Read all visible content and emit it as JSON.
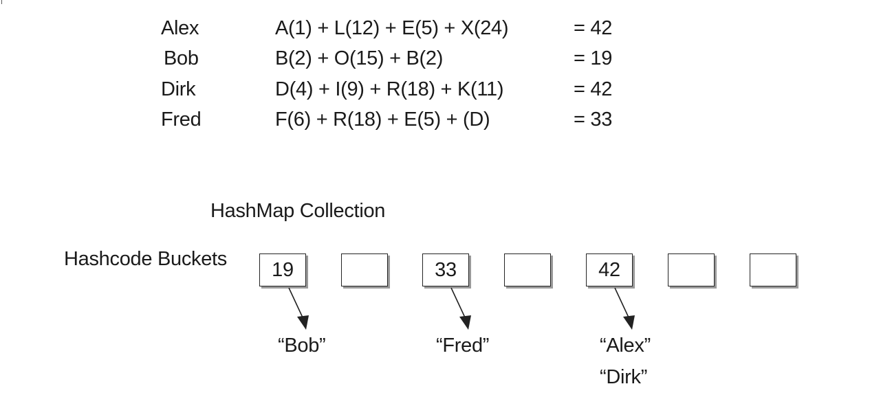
{
  "hash_table": [
    {
      "name": "Alex",
      "formula": "A(1) + L(12) + E(5) + X(24)",
      "result": "= 42"
    },
    {
      "name": "Bob",
      "formula": "B(2) + O(15) + B(2)",
      "result": "= 19"
    },
    {
      "name": "Dirk",
      "formula": "D(4) + I(9) + R(18) + K(11)",
      "result": "= 42"
    },
    {
      "name": "Fred",
      "formula": "F(6) + R(18) + E(5) + (D)",
      "result": "= 33"
    }
  ],
  "collection_title": "HashMap Collection",
  "buckets_label": "Hashcode Buckets",
  "buckets": [
    {
      "value": "19",
      "entries": [
        "“Bob”"
      ]
    },
    {
      "value": "",
      "entries": []
    },
    {
      "value": "33",
      "entries": [
        "“Fred”"
      ]
    },
    {
      "value": "",
      "entries": []
    },
    {
      "value": "42",
      "entries": [
        "“Alex”",
        "“Dirk”"
      ]
    },
    {
      "value": "",
      "entries": []
    },
    {
      "value": "",
      "entries": []
    }
  ],
  "colors": {
    "text": "#1a1a1a",
    "box_border": "#222222",
    "box_shadow": "#9a9a9a"
  }
}
